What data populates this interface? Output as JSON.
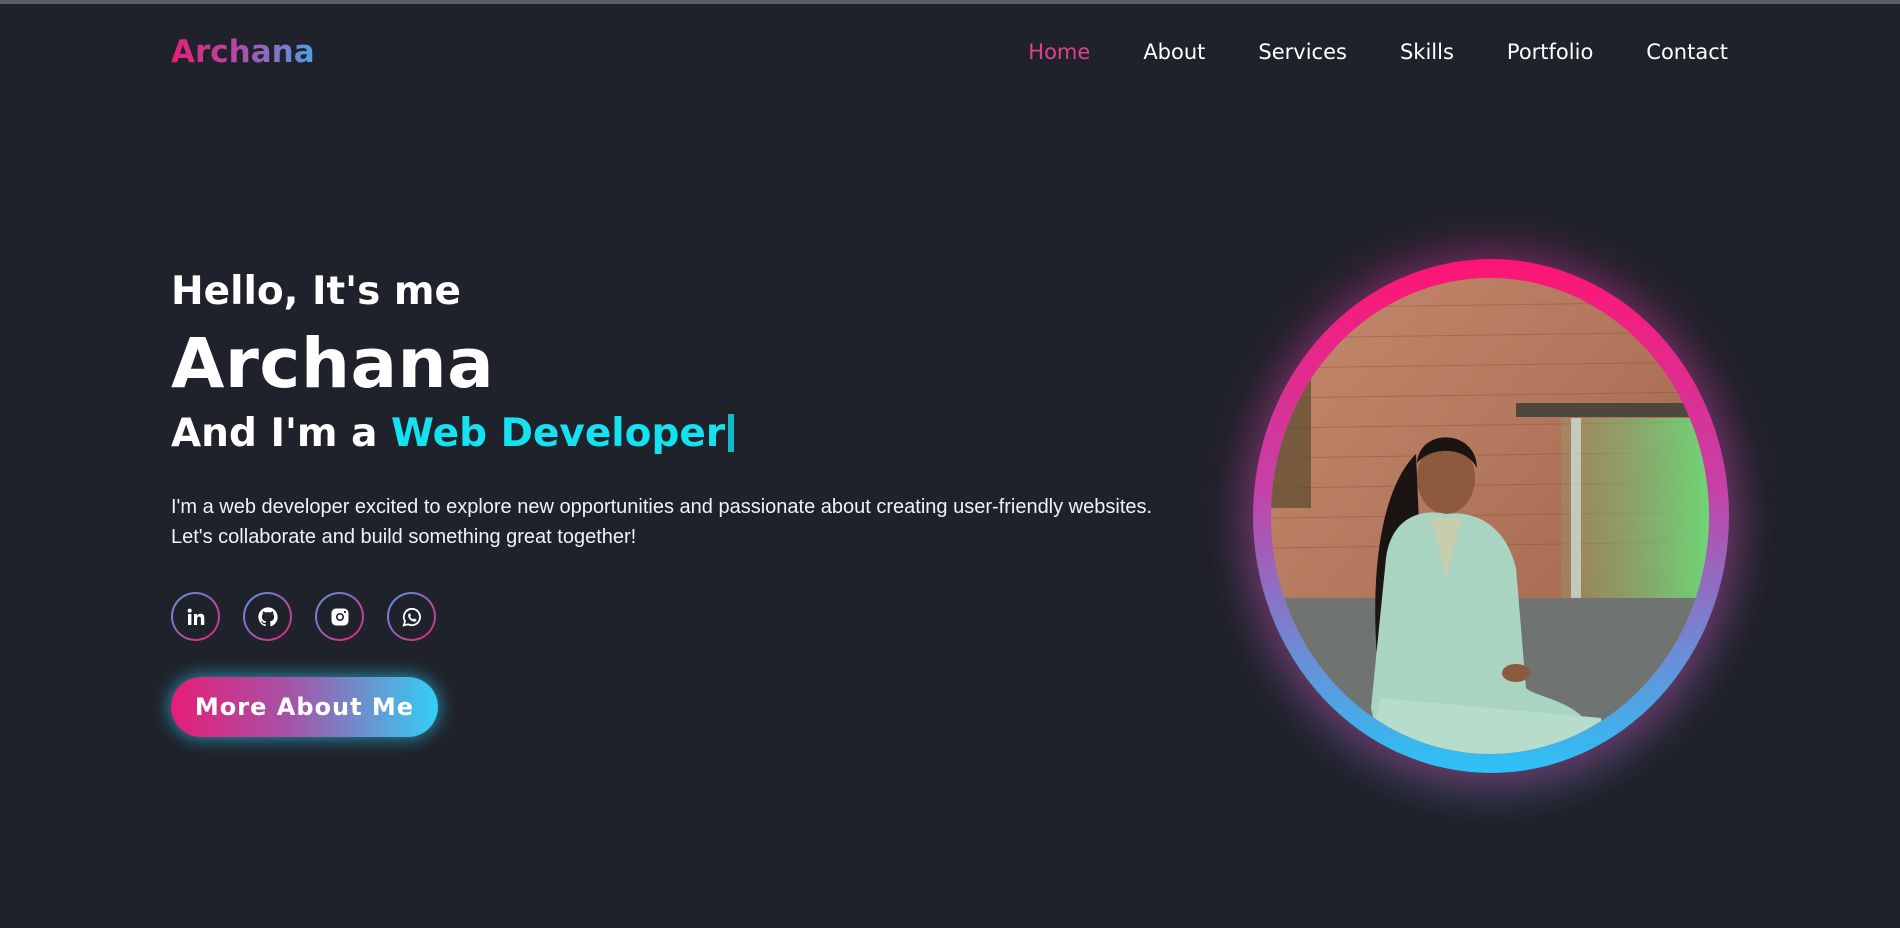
{
  "logo": "Archana",
  "nav": {
    "items": [
      {
        "label": "Home",
        "active": true
      },
      {
        "label": "About"
      },
      {
        "label": "Services"
      },
      {
        "label": "Skills"
      },
      {
        "label": "Portfolio"
      },
      {
        "label": "Contact"
      }
    ]
  },
  "hero": {
    "greeting": "Hello, It's me",
    "name": "Archana",
    "role_prefix": "And I'm a",
    "role_typed": "Web Developer",
    "description": "I'm a web developer excited to explore new opportunities and passionate about creating user-friendly websites.",
    "description2": "Let's collaborate and build something great together!",
    "cta_label": "More About Me"
  },
  "socials": [
    {
      "icon": "linkedin-icon"
    },
    {
      "icon": "github-icon"
    },
    {
      "icon": "instagram-icon"
    },
    {
      "icon": "whatsapp-icon"
    }
  ],
  "colors": {
    "background": "#1f222b",
    "accent_pink": "#e61d78",
    "accent_blue": "#4f9fe6",
    "accent_cyan": "#14e2f0",
    "nav_active": "#e0418c"
  }
}
